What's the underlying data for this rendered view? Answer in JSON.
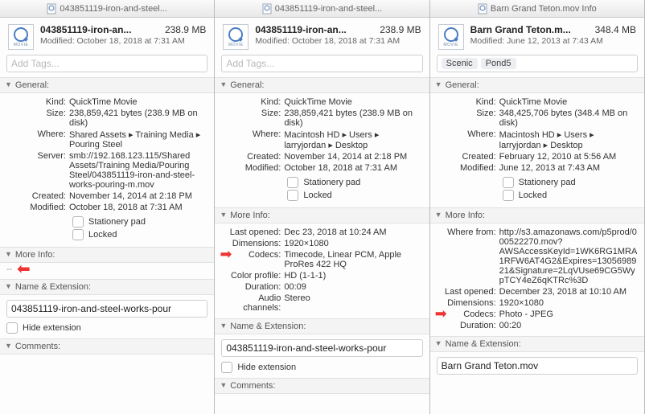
{
  "panels": [
    {
      "titlebar": "043851119-iron-and-steel...",
      "header": {
        "name": "043851119-iron-an...",
        "size": "238.9 MB",
        "modified": "Modified: October 18, 2018 at 7:31 AM"
      },
      "tags_placeholder": "Add Tags...",
      "tags": [],
      "general_header": "General:",
      "general": [
        {
          "label": "Kind:",
          "value": "QuickTime Movie"
        },
        {
          "label": "Size:",
          "value": "238,859,421 bytes (238.9 MB on disk)"
        },
        {
          "label": "Where:",
          "value": "Shared Assets ▸ Training Media ▸ Pouring Steel"
        },
        {
          "label": "Server:",
          "value": "smb://192.168.123.115/Shared Assets/Training Media/Pouring Steel/043851119-iron-and-steel-works-pouring-m.mov"
        },
        {
          "label": "Created:",
          "value": "November 14, 2014 at 2:18 PM"
        },
        {
          "label": "Modified:",
          "value": "October 18, 2018 at 7:31 AM"
        }
      ],
      "stationery": "Stationery pad",
      "locked": "Locked",
      "more_header": "More Info:",
      "more_empty": "--",
      "name_header": "Name & Extension:",
      "name_value": "043851119-iron-and-steel-works-pour",
      "hide_ext": "Hide extension",
      "comments_header": "Comments:"
    },
    {
      "titlebar": "043851119-iron-and-steel...",
      "header": {
        "name": "043851119-iron-an...",
        "size": "238.9 MB",
        "modified": "Modified: October 18, 2018 at 7:31 AM"
      },
      "tags_placeholder": "Add Tags...",
      "tags": [],
      "general_header": "General:",
      "general": [
        {
          "label": "Kind:",
          "value": "QuickTime Movie"
        },
        {
          "label": "Size:",
          "value": "238,859,421 bytes (238.9 MB on disk)"
        },
        {
          "label": "Where:",
          "value": "Macintosh HD ▸ Users ▸ larryjordan ▸ Desktop"
        },
        {
          "label": "Created:",
          "value": "November 14, 2014 at 2:18 PM"
        },
        {
          "label": "Modified:",
          "value": "October 18, 2018 at 7:31 AM"
        }
      ],
      "stationery": "Stationery pad",
      "locked": "Locked",
      "more_header": "More Info:",
      "more": [
        {
          "label": "Last opened:",
          "value": "Dec 23, 2018 at 10:24 AM"
        },
        {
          "label": "Dimensions:",
          "value": "1920×1080"
        },
        {
          "label": "Codecs:",
          "value": "Timecode, Linear PCM, Apple ProRes 422 HQ",
          "arrow": true
        },
        {
          "label": "Color profile:",
          "value": "HD (1-1-1)"
        },
        {
          "label": "Duration:",
          "value": "00:09"
        },
        {
          "label": "Audio channels:",
          "value": "Stereo"
        }
      ],
      "name_header": "Name & Extension:",
      "name_value": "043851119-iron-and-steel-works-pour",
      "hide_ext": "Hide extension",
      "comments_header": "Comments:"
    },
    {
      "titlebar": "Barn Grand Teton.mov Info",
      "header": {
        "name": "Barn Grand Teton.m...",
        "size": "348.4 MB",
        "modified": "Modified: June 12, 2013 at 7:43 AM"
      },
      "tags_placeholder": "",
      "tags": [
        "Scenic",
        "Pond5"
      ],
      "general_header": "General:",
      "general": [
        {
          "label": "Kind:",
          "value": "QuickTime Movie"
        },
        {
          "label": "Size:",
          "value": "348,425,706 bytes (348.4 MB on disk)"
        },
        {
          "label": "Where:",
          "value": "Macintosh HD ▸ Users ▸ larryjordan ▸ Desktop"
        },
        {
          "label": "Created:",
          "value": "February 12, 2010 at 5:56 AM"
        },
        {
          "label": "Modified:",
          "value": "June 12, 2013 at 7:43 AM"
        }
      ],
      "stationery": "Stationery pad",
      "locked": "Locked",
      "more_header": "More Info:",
      "more": [
        {
          "label": "Where from:",
          "value": "http://s3.amazonaws.com/p5prod/000522270.mov?AWSAccessKeyId=1WK6RG1MRA1RFW6AT4G2&Expires=1305698921&Signature=2LqVUse69CG5WypTCY4eZ6qKTRc%3D"
        },
        {
          "label": "Last opened:",
          "value": "December 23, 2018 at 10:10 AM"
        },
        {
          "label": "Dimensions:",
          "value": "1920×1080"
        },
        {
          "label": "Codecs:",
          "value": "Photo - JPEG",
          "arrow": true
        },
        {
          "label": "Duration:",
          "value": "00:20"
        }
      ],
      "name_header": "Name & Extension:",
      "name_value": "Barn Grand Teton.mov",
      "comments_header": ""
    }
  ]
}
